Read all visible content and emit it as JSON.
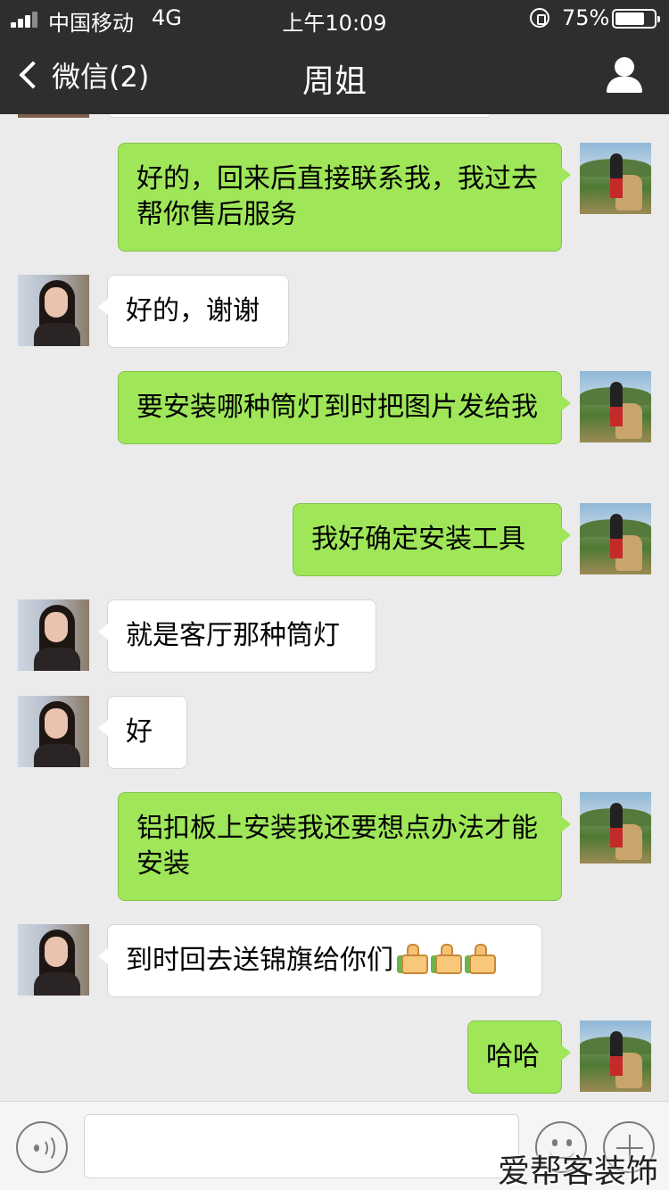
{
  "status_bar": {
    "carrier": "中国移动",
    "network": "4G",
    "time": "上午10:09",
    "battery_percent_label": "75%",
    "battery_level": 0.75
  },
  "nav": {
    "back_label": "微信(2)",
    "title": "周姐",
    "back_icon": "chevron-left-icon",
    "profile_icon": "person-icon"
  },
  "messages": [
    {
      "sender": "me",
      "text": "好的，回来后直接联系我，我过去帮你售后服务"
    },
    {
      "sender": "her",
      "text": "好的，谢谢"
    },
    {
      "sender": "me",
      "text": "要安装哪种筒灯到时把图片发给我"
    },
    {
      "sender": "me",
      "text": "我好确定安装工具"
    },
    {
      "sender": "her",
      "text": "就是客厅那种筒灯"
    },
    {
      "sender": "her",
      "text": "好"
    },
    {
      "sender": "me",
      "text": "铝扣板上安装我还要想点办法才能安装"
    },
    {
      "sender": "her",
      "text": "到时回去送锦旗给你们",
      "emoji": "thumbs-up-icon x3"
    },
    {
      "sender": "me",
      "text": "哈哈"
    }
  ],
  "input_bar": {
    "voice_icon": "voice-icon",
    "emoji_icon": "emoji-icon",
    "plus_icon": "plus-icon",
    "text_value": ""
  },
  "watermark": "爱帮客装饰",
  "colors": {
    "nav_bg": "#2e2e2e",
    "chat_bg": "#ebebeb",
    "my_bubble": "#9fe659",
    "their_bubble": "#ffffff"
  }
}
